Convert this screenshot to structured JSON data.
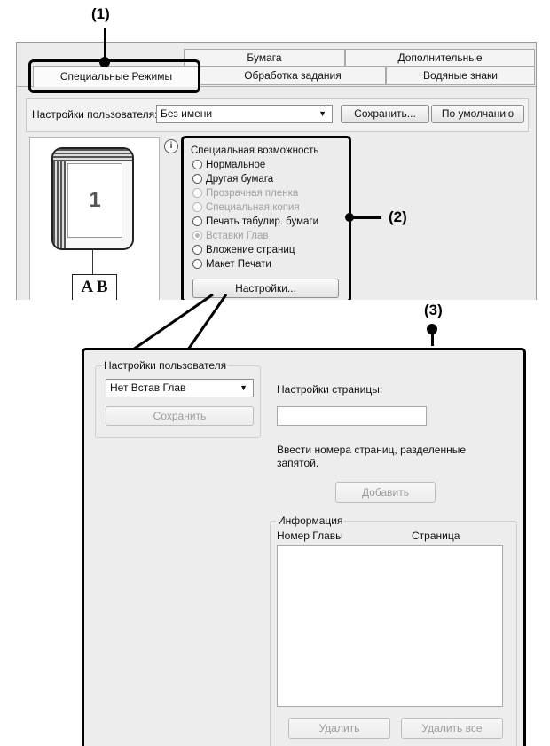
{
  "callouts": {
    "c1": "(1)",
    "c2": "(2)",
    "c3": "(3)"
  },
  "tabs": {
    "back": [
      "Бумага",
      "Дополнительные"
    ],
    "front": [
      "Специальные Режимы",
      "Обработка задания",
      "Водяные знаки"
    ]
  },
  "user_settings": {
    "label": "Настройки пользователя:",
    "value": "Без имени",
    "save_label": "Сохранить...",
    "default_label": "По умолчанию"
  },
  "preview": {
    "page_number": "1",
    "book_letters": "A B"
  },
  "special": {
    "group_title": "Специальная возможность",
    "options": [
      {
        "label": "Нормальное",
        "state": "enabled"
      },
      {
        "label": "Другая бумага",
        "state": "enabled"
      },
      {
        "label": "Прозрачная пленка",
        "state": "disabled"
      },
      {
        "label": "Специальная копия",
        "state": "disabled"
      },
      {
        "label": "Печать табулир. бумаги",
        "state": "enabled"
      },
      {
        "label": "Вставки Глав",
        "state": "selected-disabled"
      },
      {
        "label": "Вложение страниц",
        "state": "enabled"
      },
      {
        "label": "Макет Печати",
        "state": "enabled"
      }
    ],
    "settings_button": "Настройки..."
  },
  "chapter_panel": {
    "user_group_title": "Настройки пользователя",
    "preset_value": "Нет Встав Глав",
    "save_label": "Сохранить",
    "page_settings_label": "Настройки страницы:",
    "page_input_value": "",
    "hint": "Ввести номера страниц, разделенные запятой.",
    "add_label": "Добавить",
    "info_title": "Информация",
    "col_chapter": "Номер Главы",
    "col_page": "Страница",
    "delete_label": "Удалить",
    "delete_all_label": "Удалить все"
  }
}
